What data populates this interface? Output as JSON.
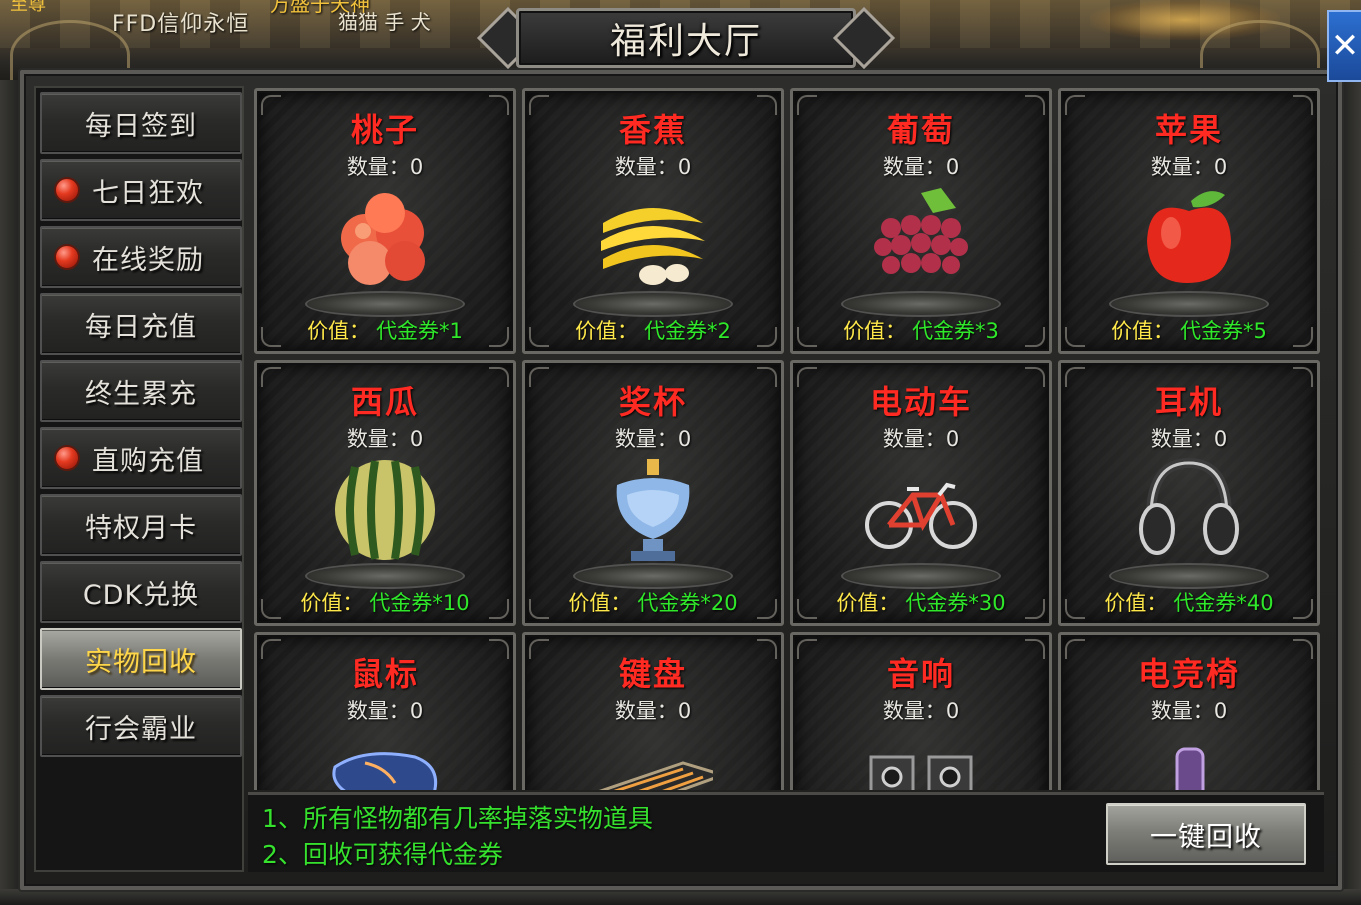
{
  "window": {
    "title": "福利大厅",
    "close_symbol": "✕"
  },
  "top_bar": {
    "ticker_left": "至尊",
    "ticker_main": "FFD信仰永恒",
    "ticker_gold": "万盛于天神",
    "ticker_player": "猫猫 手 犬"
  },
  "menu": {
    "items": [
      {
        "label": "每日签到",
        "dot": false,
        "active": false
      },
      {
        "label": "七日狂欢",
        "dot": true,
        "active": false
      },
      {
        "label": "在线奖励",
        "dot": true,
        "active": false
      },
      {
        "label": "每日充值",
        "dot": false,
        "active": false
      },
      {
        "label": "终生累充",
        "dot": false,
        "active": false
      },
      {
        "label": "直购充值",
        "dot": true,
        "active": false
      },
      {
        "label": "特权月卡",
        "dot": false,
        "active": false
      },
      {
        "label": "CDK兑换",
        "dot": false,
        "active": false
      },
      {
        "label": "实物回收",
        "dot": false,
        "active": true
      },
      {
        "label": "行会霸业",
        "dot": false,
        "active": false
      }
    ]
  },
  "items": [
    {
      "name": "桃子",
      "qty_label": "数量：",
      "qty": "0",
      "value_label": "价值：",
      "value": "代金券*1",
      "icon": "peach-icon"
    },
    {
      "name": "香蕉",
      "qty_label": "数量：",
      "qty": "0",
      "value_label": "价值：",
      "value": "代金券*2",
      "icon": "banana-icon"
    },
    {
      "name": "葡萄",
      "qty_label": "数量：",
      "qty": "0",
      "value_label": "价值：",
      "value": "代金券*3",
      "icon": "grape-icon"
    },
    {
      "name": "苹果",
      "qty_label": "数量：",
      "qty": "0",
      "value_label": "价值：",
      "value": "代金券*5",
      "icon": "apple-icon"
    },
    {
      "name": "西瓜",
      "qty_label": "数量：",
      "qty": "0",
      "value_label": "价值：",
      "value": "代金券*10",
      "icon": "watermelon-icon"
    },
    {
      "name": "奖杯",
      "qty_label": "数量：",
      "qty": "0",
      "value_label": "价值：",
      "value": "代金券*20",
      "icon": "trophy-icon"
    },
    {
      "name": "电动车",
      "qty_label": "数量：",
      "qty": "0",
      "value_label": "价值：",
      "value": "代金券*30",
      "icon": "bicycle-icon"
    },
    {
      "name": "耳机",
      "qty_label": "数量：",
      "qty": "0",
      "value_label": "价值：",
      "value": "代金券*40",
      "icon": "headphones-icon"
    },
    {
      "name": "鼠标",
      "qty_label": "数量：",
      "qty": "0",
      "value_label": "",
      "value": "",
      "icon": "mouse-icon"
    },
    {
      "name": "键盘",
      "qty_label": "数量：",
      "qty": "0",
      "value_label": "",
      "value": "",
      "icon": "keyboard-icon"
    },
    {
      "name": "音响",
      "qty_label": "数量：",
      "qty": "0",
      "value_label": "",
      "value": "",
      "icon": "speaker-icon"
    },
    {
      "name": "电竞椅",
      "qty_label": "数量：",
      "qty": "0",
      "value_label": "",
      "value": "",
      "icon": "gaming-chair-icon"
    }
  ],
  "info": {
    "line1": "1、所有怪物都有几率掉落实物道具",
    "line2": "2、回收可获得代金券"
  },
  "actions": {
    "recycle_all": "一键回收"
  },
  "colors": {
    "item_name": "#ff2a22",
    "value_label": "#ffe84a",
    "value_text": "#2fe82a",
    "info_text": "#36e12e",
    "active_menu_text": "#ffd648"
  }
}
